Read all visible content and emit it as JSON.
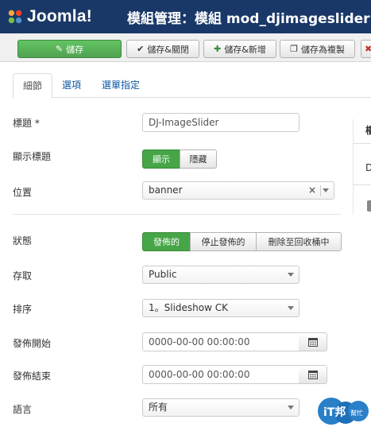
{
  "header": {
    "logo_text": "Joomla!",
    "title": "模組管理：模組 mod_djimageslider"
  },
  "toolbar": {
    "save": "儲存",
    "save_close": "儲存&關閉",
    "save_new": "儲存&新增",
    "save_copy": "儲存為複製"
  },
  "tabs": [
    "細節",
    "選項",
    "選單指定"
  ],
  "form": {
    "title_label": "標題 *",
    "title_value": "DJ-ImageSlider",
    "show_title_label": "顯示標題",
    "show_title_options": [
      "顯示",
      "隱藏"
    ],
    "position_label": "位置",
    "position_value": "banner",
    "status_label": "狀態",
    "status_options": [
      "發佈的",
      "停止發佈的",
      "刪除至回收桶中"
    ],
    "access_label": "存取",
    "access_value": "Public",
    "ordering_label": "排序",
    "ordering_value": "1。Slideshow CK",
    "publish_up_label": "發佈開始",
    "publish_up_value": "0000-00-00 00:00:00",
    "publish_down_label": "發佈結束",
    "publish_down_value": "0000-00-00 00:00:00",
    "language_label": "語言",
    "language_value": "所有"
  },
  "sidebar": {
    "frag1": "樓",
    "frag2": "D"
  },
  "watermark": {
    "brand": "iT邦",
    "sub": "幫忙"
  },
  "colors": {
    "header_bg": "#1a3867",
    "save_green": "#51a351",
    "active_toggle": "#46a546",
    "link_blue": "#0b58a2"
  }
}
